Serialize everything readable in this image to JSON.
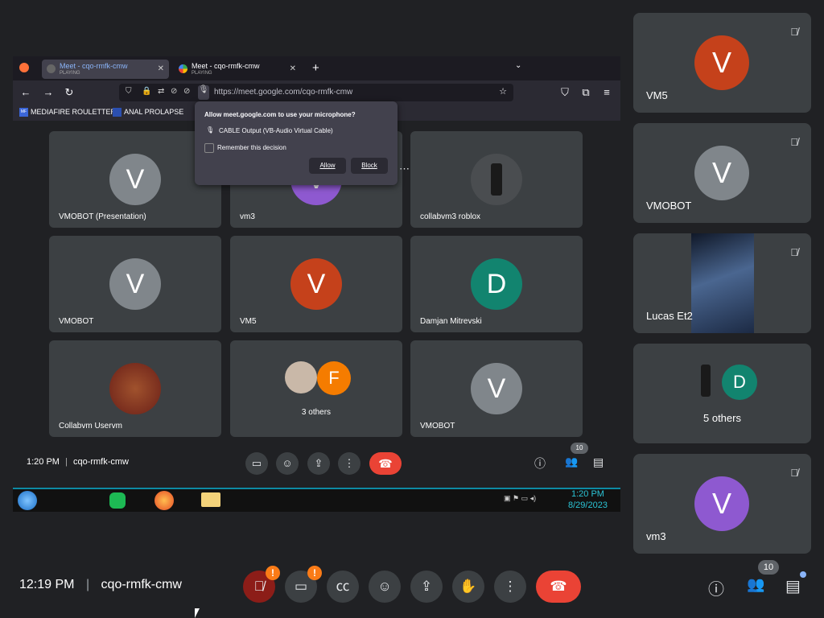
{
  "shared_screen": {
    "browser": {
      "tabs": [
        {
          "title": "Meet - cqo-rmfk-cmw",
          "status": "PLAYING",
          "active": true
        },
        {
          "title": "Meet - cqo-rmfk-cmw",
          "status": "PLAYING",
          "active": false
        }
      ],
      "new_tab": "+",
      "url": "https://meet.google.com/cqo-rmfk-cmw",
      "bookmarks": [
        {
          "icon": "mediafire-icon",
          "label": "MEDIAFIRE ROULETTER"
        },
        {
          "icon": "bookmark-icon",
          "label": "ANAL PROLAPSE"
        }
      ]
    },
    "permission_popup": {
      "title": "Allow meet.google.com to use your microphone?",
      "device": "CABLE Output (VB-Audio Virtual Cable)",
      "remember": "Remember this decision",
      "allow": "Allow",
      "block": "Block"
    },
    "tiles": [
      {
        "name": "VMOBOT (Presentation)",
        "initial": "V",
        "color": "#80868b",
        "kind": "letter"
      },
      {
        "name": "vm3",
        "initial": "V",
        "color": "#8e59d0",
        "kind": "letter"
      },
      {
        "name": "collabvm3 roblox",
        "initial": "",
        "color": "#5f6368",
        "kind": "photo"
      },
      {
        "name": "VMOBOT",
        "initial": "V",
        "color": "#80868b",
        "kind": "letter"
      },
      {
        "name": "VM5",
        "initial": "V",
        "color": "#c5411b",
        "kind": "letter"
      },
      {
        "name": "Damjan Mitrevski",
        "initial": "D",
        "color": "#12846f",
        "kind": "letter"
      },
      {
        "name": "Collabvm Uservm",
        "initial": "",
        "color": "#7a3a2a",
        "kind": "photo"
      },
      {
        "name": "3 others",
        "initial": "F",
        "color": "#f57c00",
        "kind": "others"
      },
      {
        "name": "VMOBOT",
        "initial": "V",
        "color": "#80868b",
        "kind": "letter"
      }
    ],
    "meeting_time": "1:20 PM",
    "meeting_code": "cqo-rmfk-cmw",
    "participants_count": "10",
    "taskbar": {
      "time": "1:20 PM",
      "date": "8/29/2023"
    }
  },
  "sidebar": [
    {
      "name": "VM5",
      "initial": "V",
      "color": "#c5411b",
      "muted": true,
      "kind": "letter"
    },
    {
      "name": "VMOBOT",
      "initial": "V",
      "color": "#80868b",
      "muted": true,
      "kind": "letter"
    },
    {
      "name": "Lucas Et2",
      "initial": "",
      "color": "#2a3348",
      "muted": true,
      "kind": "video"
    },
    {
      "name": "5 others",
      "initial": "D",
      "color": "#12846f",
      "muted": false,
      "kind": "others"
    },
    {
      "name": "vm3",
      "initial": "V",
      "color": "#8e59d0",
      "muted": true,
      "kind": "letter"
    }
  ],
  "bottom_bar": {
    "time": "12:19 PM",
    "meeting_code": "cqo-rmfk-cmw",
    "participants_count": "10"
  }
}
